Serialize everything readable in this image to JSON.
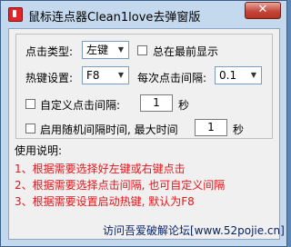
{
  "window": {
    "title": "鼠标连点器Clean1love去弹窗版",
    "close_label": "✕"
  },
  "settings": {
    "click_type_label": "点击类型:",
    "click_type_value": "左键",
    "always_on_top_label": "总在最前显示",
    "always_on_top_checked": false,
    "hotkey_label": "热键设置:",
    "hotkey_value": "F8",
    "interval_label": "每次点击间隔:",
    "interval_value": "0.1",
    "custom_interval_label": "自定义点击间隔:",
    "custom_interval_checked": false,
    "custom_interval_value": "1",
    "custom_interval_unit": "秒",
    "random_interval_label": "启用随机间隔时间, 最大时间",
    "random_interval_checked": false,
    "random_interval_value": "1",
    "random_interval_unit": "秒"
  },
  "instructions": {
    "heading": "使用说明:",
    "lines": [
      "1、根据需要选择好左键或右键点击",
      "2、根据需要选择点击间隔, 也可自定义间隔",
      "3、根据需要设置启动热键, 默认为F8"
    ]
  },
  "footer": {
    "link_text": "访问吾爱破解论坛[www.52pojie.cn]"
  },
  "colors": {
    "frame": "#c4d8ee",
    "close_button": "#c4473a",
    "instruction_text": "#e8141a",
    "link_text": "#0a246a"
  },
  "icons": {
    "app": "app-icon",
    "close": "close-icon",
    "dropdown": "chevron-down-icon"
  }
}
